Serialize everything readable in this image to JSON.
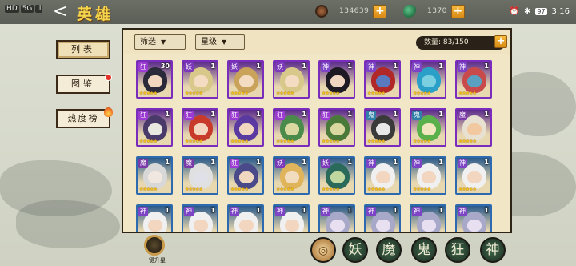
{
  "status_bar": {
    "network": [
      "HD",
      "5G",
      "il"
    ],
    "time": "3:16",
    "battery": "97"
  },
  "header": {
    "back_label": "<",
    "title": "英雄"
  },
  "resources": [
    {
      "icon": "coin-icon",
      "value": "134639",
      "plus": "+",
      "color": "#8a5a3c"
    },
    {
      "icon": "jade-icon",
      "value": "1370",
      "plus": "+",
      "color": "#2e8a5a"
    }
  ],
  "menu": [
    {
      "label": "列表",
      "active": true
    },
    {
      "label": "图鉴",
      "badge": "red-dot"
    },
    {
      "label": "热度榜",
      "badge": "fire"
    }
  ],
  "filters": {
    "filter_label": "筛选",
    "star_label": "星级"
  },
  "capacity": {
    "label": "数量",
    "text": "数量: 83/150",
    "plus": "+"
  },
  "class_colors": {
    "狂": "#9b3bd2",
    "妖": "#7b38b8",
    "神": "#7e44c6",
    "鬼": "#2f7fa8",
    "魔": "#7b3aa8"
  },
  "heroes": [
    {
      "cls": "狂",
      "level": "30",
      "stars": 5,
      "border": "#7a2dbd",
      "hair": "#2a2a3a",
      "skin": "#f1d7c0"
    },
    {
      "cls": "妖",
      "level": "1",
      "stars": 5,
      "border": "#7a2dbd",
      "hair": "#d8c88a",
      "skin": "#f3dcc2"
    },
    {
      "cls": "妖",
      "level": "1",
      "stars": 5,
      "border": "#7a2dbd",
      "hair": "#caa35a",
      "skin": "#f3dcc2"
    },
    {
      "cls": "妖",
      "level": "1",
      "stars": 5,
      "border": "#7a2dbd",
      "hair": "#d8c88a",
      "skin": "#f3dcc2"
    },
    {
      "cls": "神",
      "level": "1",
      "stars": 5,
      "border": "#7a2dbd",
      "hair": "#1e1a24",
      "skin": "#f0d6c0"
    },
    {
      "cls": "神",
      "level": "1",
      "stars": 5,
      "border": "#7a2dbd",
      "hair": "#b02828",
      "skin": "#5a7ac0"
    },
    {
      "cls": "神",
      "level": "1",
      "stars": 5,
      "border": "#7a2dbd",
      "hair": "#2aa0c8",
      "skin": "#7ad0e0"
    },
    {
      "cls": "神",
      "level": "1",
      "stars": 5,
      "border": "#7a2dbd",
      "hair": "#c84a4a",
      "skin": "#5aa0c0"
    },
    {
      "cls": "狂",
      "level": "1",
      "stars": 5,
      "border": "#7a2dbd",
      "hair": "#4a3a6a",
      "skin": "#e8e8e0"
    },
    {
      "cls": "狂",
      "level": "1",
      "stars": 5,
      "border": "#7a2dbd",
      "hair": "#c83a2a",
      "skin": "#f2d6c0"
    },
    {
      "cls": "狂",
      "level": "1",
      "stars": 5,
      "border": "#7a2dbd",
      "hair": "#5a3aa0",
      "skin": "#f2d6c0"
    },
    {
      "cls": "狂",
      "level": "1",
      "stars": 5,
      "border": "#7a2dbd",
      "hair": "#4a8a4a",
      "skin": "#d8d8a0"
    },
    {
      "cls": "狂",
      "level": "1",
      "stars": 5,
      "border": "#7a2dbd",
      "hair": "#4a7a3a",
      "skin": "#d8d8a0"
    },
    {
      "cls": "鬼",
      "level": "1",
      "stars": 5,
      "border": "#7a2dbd",
      "hair": "#3a3a3a",
      "skin": "#e8e8e8"
    },
    {
      "cls": "鬼",
      "level": "1",
      "stars": 5,
      "border": "#7a2dbd",
      "hair": "#5ab04a",
      "skin": "#f2e6c0"
    },
    {
      "cls": "魔",
      "level": "1",
      "stars": 5,
      "border": "#7a2dbd",
      "hair": "#e8e0d0",
      "skin": "#f2c8a0"
    },
    {
      "cls": "魔",
      "level": "1",
      "stars": 5,
      "border": "#2e6ab0",
      "hair": "#d8d8d8",
      "skin": "#f0e8e0"
    },
    {
      "cls": "魔",
      "level": "1",
      "stars": 5,
      "border": "#2e6ab0",
      "hair": "#e0e0e0",
      "skin": "#e0e0e8"
    },
    {
      "cls": "狂",
      "level": "1",
      "stars": 5,
      "border": "#2e6ab0",
      "hair": "#4a4a8a",
      "skin": "#f0d8c0"
    },
    {
      "cls": "妖",
      "level": "1",
      "stars": 5,
      "border": "#2e6ab0",
      "hair": "#e0b45a",
      "skin": "#f2dcc0"
    },
    {
      "cls": "妖",
      "level": "1",
      "stars": 5,
      "border": "#2e6ab0",
      "hair": "#2a6a5a",
      "skin": "#c0d8a0"
    },
    {
      "cls": "神",
      "level": "1",
      "stars": 5,
      "border": "#2e6ab0",
      "hair": "#f0f0f0",
      "skin": "#f2d6c0"
    },
    {
      "cls": "神",
      "level": "1",
      "stars": 5,
      "border": "#2e6ab0",
      "hair": "#f0f0f0",
      "skin": "#f2d6c0"
    },
    {
      "cls": "神",
      "level": "1",
      "stars": 5,
      "border": "#2e6ab0",
      "hair": "#f0f0f0",
      "skin": "#f2d6c0"
    },
    {
      "cls": "神",
      "level": "1",
      "stars": 5,
      "border": "#2e6ab0",
      "hair": "#f0f0f0",
      "skin": "#f2d6c0"
    },
    {
      "cls": "神",
      "level": "1",
      "stars": 5,
      "border": "#2e6ab0",
      "hair": "#f0f0f0",
      "skin": "#f2d6c0"
    },
    {
      "cls": "神",
      "level": "1",
      "stars": 5,
      "border": "#2e6ab0",
      "hair": "#f0f0f0",
      "skin": "#f2d6c0"
    },
    {
      "cls": "神",
      "level": "1",
      "stars": 5,
      "border": "#2e6ab0",
      "hair": "#f0f0f0",
      "skin": "#f2d6c0"
    },
    {
      "cls": "神",
      "level": "1",
      "stars": 5,
      "border": "#2e6ab0",
      "hair": "#a8a8c8",
      "skin": "#e8e0f0"
    },
    {
      "cls": "神",
      "level": "1",
      "stars": 5,
      "border": "#2e6ab0",
      "hair": "#a8a8c8",
      "skin": "#e8e0f0"
    },
    {
      "cls": "神",
      "level": "1",
      "stars": 5,
      "border": "#2e6ab0",
      "hair": "#a8a8c8",
      "skin": "#e8e0f0"
    },
    {
      "cls": "神",
      "level": "1",
      "stars": 5,
      "border": "#2e6ab0",
      "hair": "#a8a8c8",
      "skin": "#e8e0f0"
    }
  ],
  "bottom": {
    "upgrade_label": "一键升星",
    "tabs": [
      {
        "label": "",
        "name": "tab-all",
        "color": "#b8864a"
      },
      {
        "label": "妖",
        "name": "tab-yao",
        "color": "#3e6a4a"
      },
      {
        "label": "魔",
        "name": "tab-mo",
        "color": "#3e6a4a"
      },
      {
        "label": "鬼",
        "name": "tab-gui",
        "color": "#3e6a4a"
      },
      {
        "label": "狂",
        "name": "tab-kuang",
        "color": "#3e6a4a"
      },
      {
        "label": "神",
        "name": "tab-shen",
        "color": "#3e6a4a"
      }
    ]
  }
}
